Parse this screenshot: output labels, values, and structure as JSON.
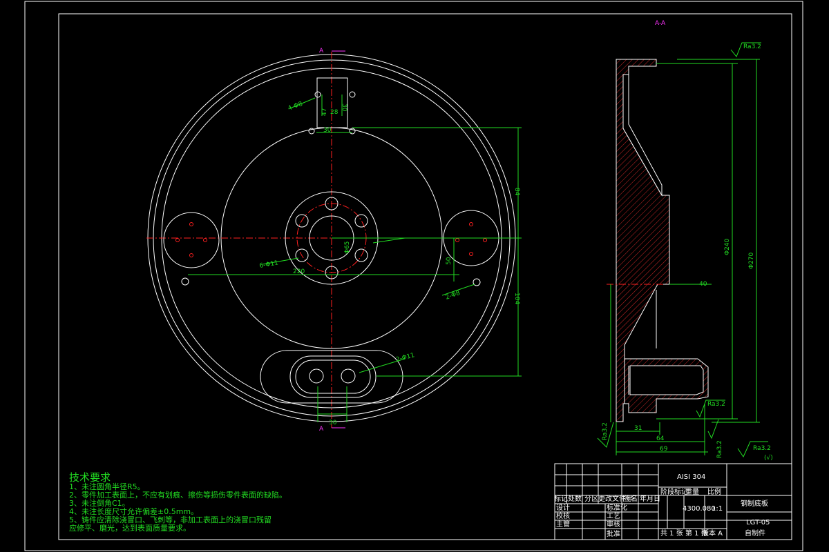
{
  "section_label": "A-A",
  "view_label_top": "A",
  "view_label_bottom": "A",
  "dims_front": {
    "d1": "4-Φ8",
    "d2": "47",
    "d3": "28",
    "d4": "30",
    "d5": "30",
    "d6": "84",
    "d7": "6-Φ11",
    "d8": "Φ65",
    "d9": "220",
    "d10": "50",
    "d11": "2-Φ8",
    "d12": "104",
    "d13": "2-Φ11",
    "d14": "30"
  },
  "dims_section": {
    "ra1": "Ra3.2",
    "ra2": "Ra3.2",
    "ra3": "Ra3.2",
    "ra4": "Ra3.2",
    "dia1": "Φ240",
    "dia2": "Φ270",
    "d40": "40",
    "d31": "31",
    "d64": "64",
    "d69": "69",
    "ra_general": "Ra3.2",
    "ra_general_note": "(√)"
  },
  "tech": {
    "title": "技术要求",
    "lines": [
      "1、未注圆角半径R5。",
      "2、零件加工表面上，不应有划痕、擦伤等损伤零件表面的缺陷。",
      "3、未注倒角C1。",
      "4、未注长度尺寸允许偏差±0.5mm。",
      "5、铸件应清除浇冒口、飞刺等，非加工表面上的浇冒口残留",
      "应修平、磨光，达到表面质量要求。"
    ]
  },
  "title_block": {
    "material": "AISI 304",
    "part_name": "钢制底板",
    "drawing_no": "LGT-05",
    "source": "自制件",
    "row_headers": [
      "标记",
      "处数",
      "分区",
      "更改文件号",
      "签名",
      "年月日"
    ],
    "design": "设计",
    "check": "校核",
    "chief": "主管",
    "std": "标准化",
    "process": "工艺",
    "review": "审核",
    "approve": "批准",
    "stage_mark": "阶段标记",
    "weight": "重量",
    "scale": "比例",
    "weight_val": "4300.080",
    "scale_val": "1:1",
    "sheets": "共 1 张  第 1 张",
    "version": "版本 A"
  }
}
